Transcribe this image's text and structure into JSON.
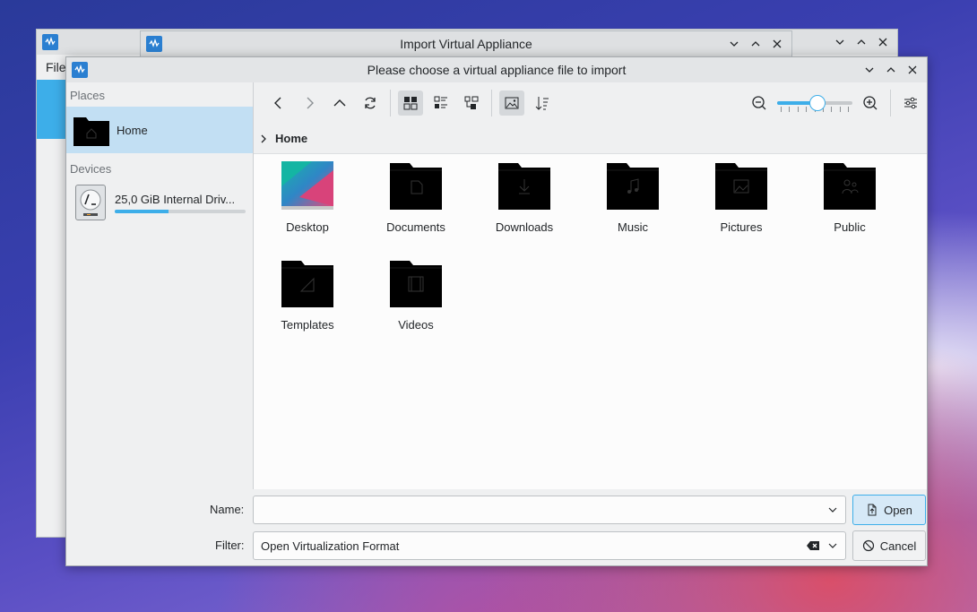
{
  "background_window": {
    "menu_first": "File"
  },
  "middle_window": {
    "title": "Import Virtual Appliance"
  },
  "dialog": {
    "title": "Please choose a virtual appliance file to import",
    "sidebar": {
      "places_heading": "Places",
      "home_label": "Home",
      "devices_heading": "Devices",
      "device_label": "25,0 GiB Internal Driv...",
      "device_usage_fraction": 0.41
    },
    "breadcrumb": "Home",
    "files": [
      {
        "name": "Desktop",
        "icon": "desktop-thumbnail-icon"
      },
      {
        "name": "Documents",
        "icon": "folder-documents-icon"
      },
      {
        "name": "Downloads",
        "icon": "folder-downloads-icon"
      },
      {
        "name": "Music",
        "icon": "folder-music-icon"
      },
      {
        "name": "Pictures",
        "icon": "folder-pictures-icon"
      },
      {
        "name": "Public",
        "icon": "folder-public-icon"
      },
      {
        "name": "Templates",
        "icon": "folder-templates-icon"
      },
      {
        "name": "Videos",
        "icon": "folder-videos-icon"
      }
    ],
    "zoom_level_fraction": 0.55,
    "name_label": "Name:",
    "name_value": "",
    "filter_label": "Filter:",
    "filter_value": "Open Virtualization Format",
    "open_label": "Open",
    "cancel_label": "Cancel"
  },
  "colors": {
    "accent": "#3daee9",
    "selection": "#c2dff3",
    "folder": "#000000"
  }
}
